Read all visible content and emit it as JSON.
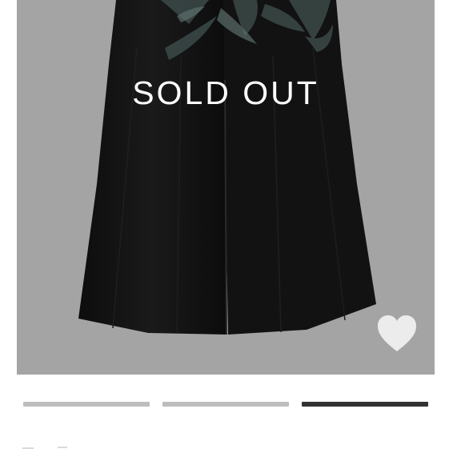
{
  "product": {
    "status_label": "SOLD OUT",
    "wishlist_icon": "heart-icon"
  },
  "carousel": {
    "slide_count": 3,
    "active_index": 2
  },
  "colors": {
    "image_background": "#a4a4a4",
    "garment": "#111111",
    "indicator_inactive": "#bdbdbd",
    "indicator_active": "#333333",
    "overlay_text": "#ffffff"
  }
}
